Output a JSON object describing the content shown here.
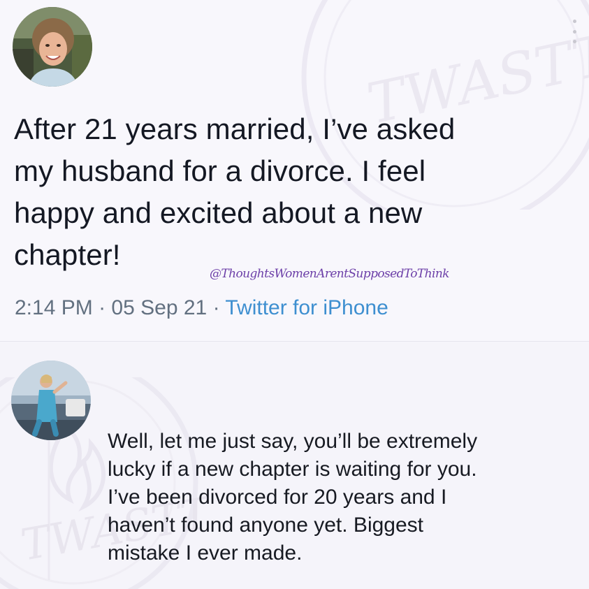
{
  "main_tweet": {
    "text": "After 21 years married, I’ve asked\nmy husband for a divorce. I feel\nhappy and excited about a new\nchapter!",
    "time": "2:14 PM",
    "separator": "·",
    "date": "05 Sep 21",
    "source": "Twitter for iPhone",
    "avatar_icon": "profile-photo-woman-smiling"
  },
  "overlay": {
    "handle": "@ThoughtsWomenArentSupposedToThink",
    "watermark_text": "TWASTT"
  },
  "reply": {
    "text": "Well, let me just say, you’ll be extremely\nlucky if a new chapter is waiting for you.\nI’ve been divorced for 20 years and I\nhaven’t found anyone yet. Biggest\nmistake I ever made.",
    "avatar_icon": "profile-photo-woman-outdoors"
  },
  "toolbar": {
    "more_icon": "vertical-ellipsis-icon"
  },
  "colors": {
    "background": "#f8f7fc",
    "text": "#141823",
    "meta": "#627080",
    "link": "#3e8fd0",
    "handle": "#6c3fa8"
  }
}
